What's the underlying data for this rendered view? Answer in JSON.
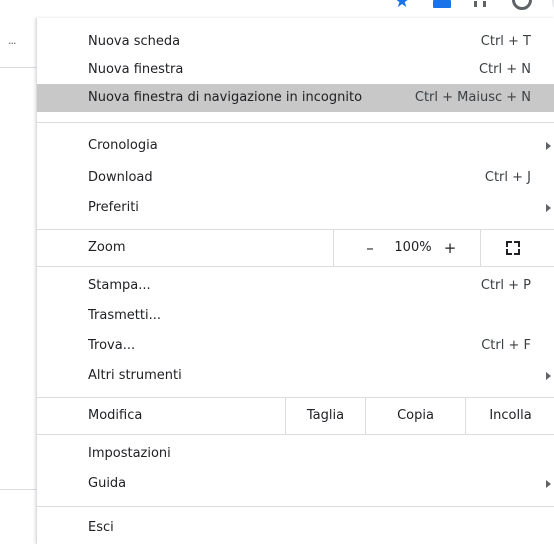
{
  "background": {
    "ellipsis": "..."
  },
  "menu": {
    "new_tab": {
      "label": "Nuova scheda",
      "shortcut": "Ctrl + T"
    },
    "new_window": {
      "label": "Nuova finestra",
      "shortcut": "Ctrl + N"
    },
    "incognito": {
      "label": "Nuova finestra di navigazione in incognito",
      "shortcut": "Ctrl + Maiusc + N"
    },
    "history": {
      "label": "Cronologia"
    },
    "downloads": {
      "label": "Download",
      "shortcut": "Ctrl + J"
    },
    "bookmarks": {
      "label": "Preferiti"
    },
    "zoom": {
      "label": "Zoom",
      "minus": "–",
      "value": "100%",
      "plus": "+"
    },
    "print": {
      "label": "Stampa...",
      "shortcut": "Ctrl + P"
    },
    "cast": {
      "label": "Trasmetti..."
    },
    "find": {
      "label": "Trova...",
      "shortcut": "Ctrl + F"
    },
    "more_tools": {
      "label": "Altri strumenti"
    },
    "edit": {
      "label": "Modifica",
      "cut": "Taglia",
      "copy": "Copia",
      "paste": "Incolla"
    },
    "settings": {
      "label": "Impostazioni"
    },
    "help": {
      "label": "Guida"
    },
    "exit": {
      "label": "Esci"
    }
  },
  "colors": {
    "highlight": "#c8c8c8",
    "separator": "#dadce0",
    "accent": "#1a73e8"
  },
  "icons": {
    "star": "star-icon",
    "extension": "extension-icon",
    "puzzle": "puzzle-icon",
    "profile": "profile-icon",
    "menu": "more-vert-icon",
    "fullscreen": "fullscreen-icon",
    "submenu": "chevron-right-icon"
  }
}
